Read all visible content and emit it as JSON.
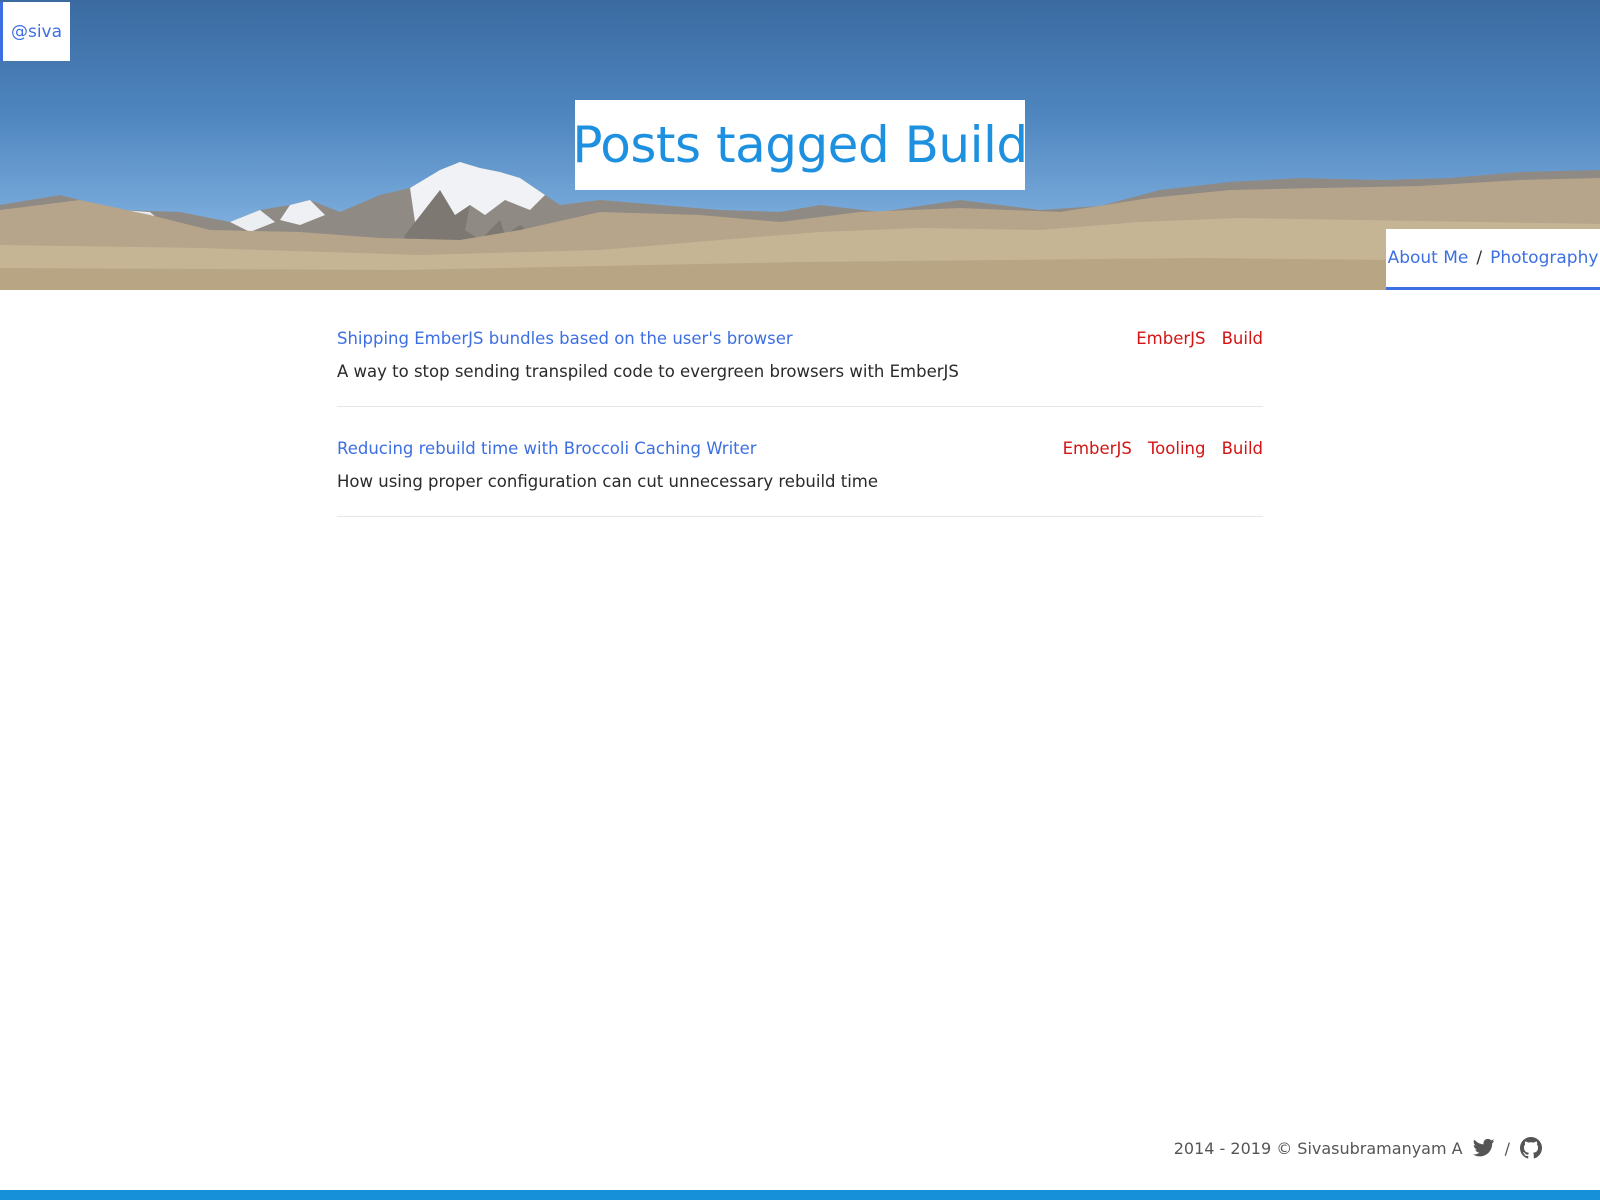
{
  "header": {
    "handle": "@siva",
    "title": "Posts tagged Build"
  },
  "nav": {
    "items": [
      {
        "label": "About Me"
      },
      {
        "label": "Photography"
      }
    ],
    "separator": "/"
  },
  "posts": [
    {
      "title": "Shipping EmberJS bundles based on the user's browser",
      "description": "A way to stop sending transpiled code to evergreen browsers with EmberJS",
      "tags": [
        "EmberJS",
        "Build"
      ]
    },
    {
      "title": "Reducing rebuild time with Broccoli Caching Writer",
      "description": "How using proper configuration can cut unnecessary rebuild time",
      "tags": [
        "EmberJS",
        "Tooling",
        "Build"
      ]
    }
  ],
  "footer": {
    "copyright": "2014 - 2019 © Sivasubramanyam A",
    "separator": "/",
    "icons": [
      "twitter-icon",
      "github-icon"
    ]
  },
  "colors": {
    "link": "#3d6fe3",
    "title": "#1e90e0",
    "tag": "#d41414",
    "accent_bar": "#1690d8"
  }
}
